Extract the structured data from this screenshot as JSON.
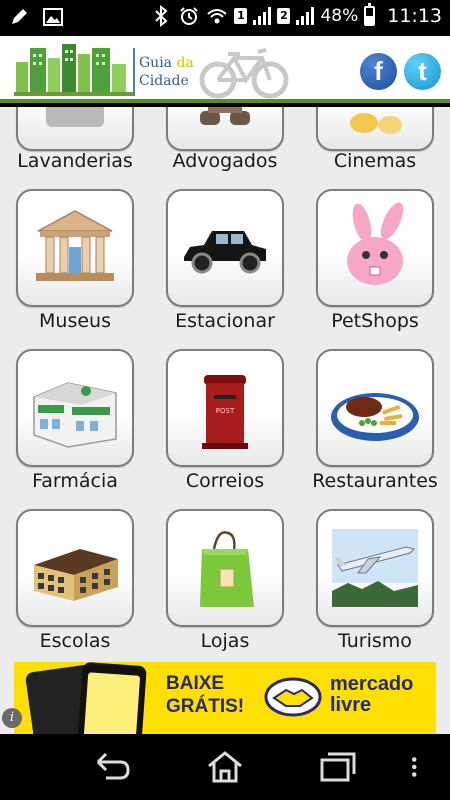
{
  "status_bar": {
    "battery_percent": "48%",
    "time": "11:13",
    "sim1": "1",
    "sim2": "2",
    "battery_level": 0.48
  },
  "header": {
    "logo_word1": "Guia",
    "logo_word2": "da",
    "logo_word3": "Cidade",
    "facebook_letter": "f",
    "twitter_letter": "t",
    "accent_color": "#5a8a2a"
  },
  "grid": {
    "items": [
      {
        "label": "Lavanderias",
        "icon": "laundry-icon"
      },
      {
        "label": "Advogados",
        "icon": "lawyer-icon"
      },
      {
        "label": "Cinemas",
        "icon": "cinema-icon"
      },
      {
        "label": "Museus",
        "icon": "museum-icon"
      },
      {
        "label": "Estacionar",
        "icon": "car-icon"
      },
      {
        "label": "PetShops",
        "icon": "bunny-icon"
      },
      {
        "label": "Farmácia",
        "icon": "pharmacy-icon"
      },
      {
        "label": "Correios",
        "icon": "postbox-icon"
      },
      {
        "label": "Restaurantes",
        "icon": "food-plate-icon"
      },
      {
        "label": "Escolas",
        "icon": "school-icon"
      },
      {
        "label": "Lojas",
        "icon": "shopping-bag-icon"
      },
      {
        "label": "Turismo",
        "icon": "airplane-icon"
      }
    ]
  },
  "ad": {
    "line1": "BAIXE",
    "line2": "GRÁTIS!",
    "brand1": "mercado",
    "brand2": "livre",
    "info": "i",
    "background_color": "#fde001"
  }
}
